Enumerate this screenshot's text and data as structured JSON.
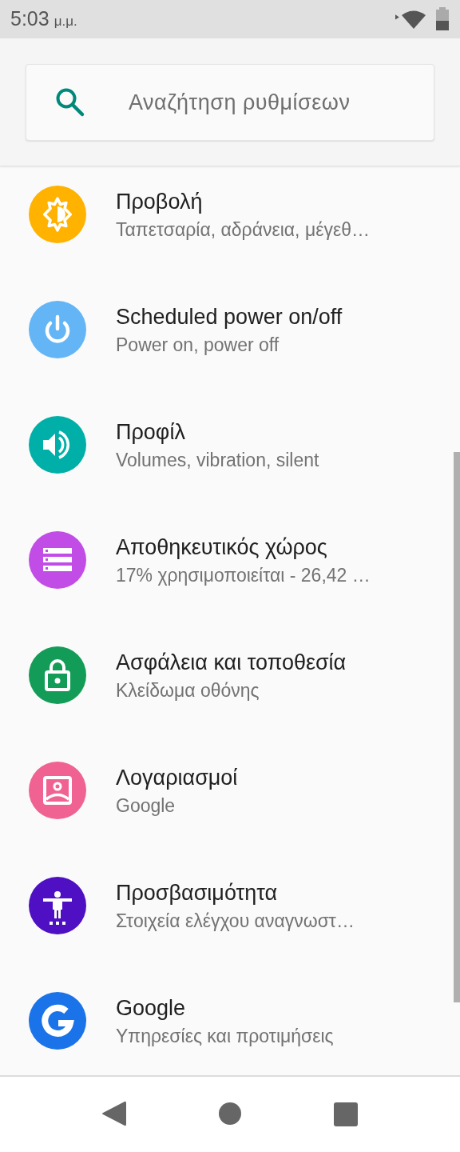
{
  "status_bar": {
    "time": "5:03",
    "period": "μ.μ."
  },
  "search": {
    "placeholder": "Αναζήτηση ρυθμίσεων"
  },
  "items": [
    {
      "kind": "display",
      "color": "#ffb300",
      "title": "Προβολή",
      "subtitle": "Ταπετσαρία, αδράνεια, μέγεθ…"
    },
    {
      "kind": "power",
      "color": "#64b5f6",
      "title": "Scheduled power on/off",
      "subtitle": "Power on, power off"
    },
    {
      "kind": "sound",
      "color": "#00b0a8",
      "title": "Προφίλ",
      "subtitle": "Volumes, vibration, silent"
    },
    {
      "kind": "storage",
      "color": "#c24de6",
      "title": "Αποθηκευτικός χώρος",
      "subtitle": "17% χρησιμοποιείται - 26,42 …"
    },
    {
      "kind": "lock",
      "color": "#129c57",
      "title": "Ασφάλεια και τοποθεσία",
      "subtitle": "Κλείδωμα οθόνης"
    },
    {
      "kind": "account",
      "color": "#f06292",
      "title": "Λογαριασμοί",
      "subtitle": "Google"
    },
    {
      "kind": "accessibility",
      "color": "#4e10c2",
      "title": "Προσβασιμότητα",
      "subtitle": "Στοιχεία ελέγχου αναγνωστ…"
    },
    {
      "kind": "google",
      "color": "#1a73e8",
      "title": "Google",
      "subtitle": "Υπηρεσίες και προτιμήσεις"
    }
  ]
}
